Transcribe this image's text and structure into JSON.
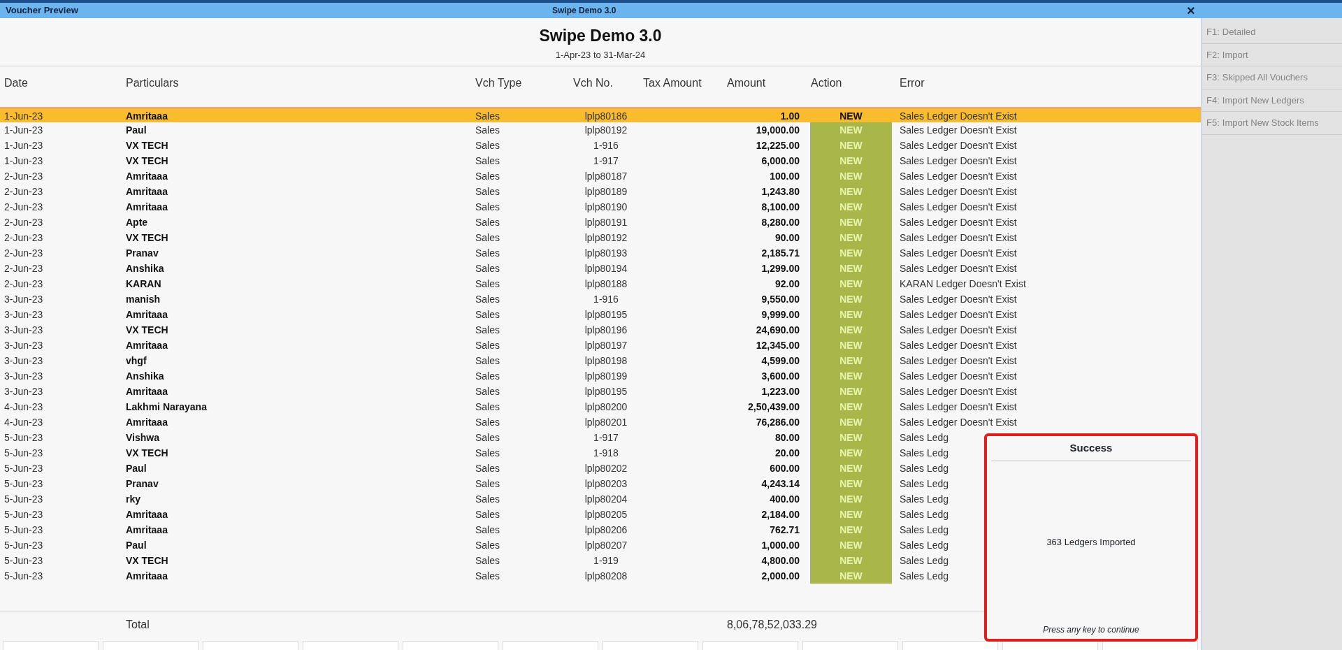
{
  "window": {
    "title": "Voucher Preview",
    "company_tab": "Swipe Demo 3.0",
    "close": "×"
  },
  "report": {
    "company": "Swipe Demo 3.0",
    "period": "1-Apr-23 to 31-Mar-24"
  },
  "table": {
    "columns": [
      "Date",
      "Particulars",
      "Vch Type",
      "Vch No.",
      "Tax Amount",
      "Amount",
      "Action",
      "Error"
    ],
    "rows": [
      {
        "date": "1-Jun-23",
        "particulars": "Amritaaa",
        "vch_type": "Sales",
        "vch_no": "lplp80186",
        "amount": "1.00",
        "action": "NEW",
        "error": "Sales Ledger Doesn't Exist",
        "selected": true
      },
      {
        "date": "1-Jun-23",
        "particulars": "Paul",
        "vch_type": "Sales",
        "vch_no": "lplp80192",
        "amount": "19,000.00",
        "action": "NEW",
        "error": "Sales Ledger Doesn't Exist",
        "selected": false
      },
      {
        "date": "1-Jun-23",
        "particulars": "VX TECH",
        "vch_type": "Sales",
        "vch_no": "1-916",
        "amount": "12,225.00",
        "action": "NEW",
        "error": "Sales Ledger Doesn't Exist",
        "selected": false
      },
      {
        "date": "1-Jun-23",
        "particulars": "VX TECH",
        "vch_type": "Sales",
        "vch_no": "1-917",
        "amount": "6,000.00",
        "action": "NEW",
        "error": "Sales Ledger Doesn't Exist",
        "selected": false
      },
      {
        "date": "2-Jun-23",
        "particulars": "Amritaaa",
        "vch_type": "Sales",
        "vch_no": "lplp80187",
        "amount": "100.00",
        "action": "NEW",
        "error": "Sales Ledger Doesn't Exist",
        "selected": false
      },
      {
        "date": "2-Jun-23",
        "particulars": "Amritaaa",
        "vch_type": "Sales",
        "vch_no": "lplp80189",
        "amount": "1,243.80",
        "action": "NEW",
        "error": "Sales Ledger Doesn't Exist",
        "selected": false
      },
      {
        "date": "2-Jun-23",
        "particulars": "Amritaaa",
        "vch_type": "Sales",
        "vch_no": "lplp80190",
        "amount": "8,100.00",
        "action": "NEW",
        "error": "Sales Ledger Doesn't Exist",
        "selected": false
      },
      {
        "date": "2-Jun-23",
        "particulars": "Apte",
        "vch_type": "Sales",
        "vch_no": "lplp80191",
        "amount": "8,280.00",
        "action": "NEW",
        "error": "Sales Ledger Doesn't Exist",
        "selected": false
      },
      {
        "date": "2-Jun-23",
        "particulars": "VX TECH",
        "vch_type": "Sales",
        "vch_no": "lplp80192",
        "amount": "90.00",
        "action": "NEW",
        "error": "Sales Ledger Doesn't Exist",
        "selected": false
      },
      {
        "date": "2-Jun-23",
        "particulars": "Pranav",
        "vch_type": "Sales",
        "vch_no": "lplp80193",
        "amount": "2,185.71",
        "action": "NEW",
        "error": "Sales Ledger Doesn't Exist",
        "selected": false
      },
      {
        "date": "2-Jun-23",
        "particulars": "Anshika",
        "vch_type": "Sales",
        "vch_no": "lplp80194",
        "amount": "1,299.00",
        "action": "NEW",
        "error": "Sales Ledger Doesn't Exist",
        "selected": false
      },
      {
        "date": "2-Jun-23",
        "particulars": "KARAN",
        "vch_type": "Sales",
        "vch_no": "lplp80188",
        "amount": "92.00",
        "action": "NEW",
        "error": "KARAN Ledger Doesn't Exist",
        "selected": false
      },
      {
        "date": "3-Jun-23",
        "particulars": "manish",
        "vch_type": "Sales",
        "vch_no": "1-916",
        "amount": "9,550.00",
        "action": "NEW",
        "error": "Sales Ledger Doesn't Exist",
        "selected": false
      },
      {
        "date": "3-Jun-23",
        "particulars": "Amritaaa",
        "vch_type": "Sales",
        "vch_no": "lplp80195",
        "amount": "9,999.00",
        "action": "NEW",
        "error": "Sales Ledger Doesn't Exist",
        "selected": false
      },
      {
        "date": "3-Jun-23",
        "particulars": "VX TECH",
        "vch_type": "Sales",
        "vch_no": "lplp80196",
        "amount": "24,690.00",
        "action": "NEW",
        "error": "Sales Ledger Doesn't Exist",
        "selected": false
      },
      {
        "date": "3-Jun-23",
        "particulars": "Amritaaa",
        "vch_type": "Sales",
        "vch_no": "lplp80197",
        "amount": "12,345.00",
        "action": "NEW",
        "error": "Sales Ledger Doesn't Exist",
        "selected": false
      },
      {
        "date": "3-Jun-23",
        "particulars": "vhgf",
        "vch_type": "Sales",
        "vch_no": "lplp80198",
        "amount": "4,599.00",
        "action": "NEW",
        "error": "Sales Ledger Doesn't Exist",
        "selected": false
      },
      {
        "date": "3-Jun-23",
        "particulars": "Anshika",
        "vch_type": "Sales",
        "vch_no": "lplp80199",
        "amount": "3,600.00",
        "action": "NEW",
        "error": "Sales Ledger Doesn't Exist",
        "selected": false
      },
      {
        "date": "3-Jun-23",
        "particulars": "Amritaaa",
        "vch_type": "Sales",
        "vch_no": "lplp80195",
        "amount": "1,223.00",
        "action": "NEW",
        "error": "Sales Ledger Doesn't Exist",
        "selected": false
      },
      {
        "date": "4-Jun-23",
        "particulars": "Lakhmi Narayana",
        "vch_type": "Sales",
        "vch_no": "lplp80200",
        "amount": "2,50,439.00",
        "action": "NEW",
        "error": "Sales Ledger Doesn't Exist",
        "selected": false
      },
      {
        "date": "4-Jun-23",
        "particulars": "Amritaaa",
        "vch_type": "Sales",
        "vch_no": "lplp80201",
        "amount": "76,286.00",
        "action": "NEW",
        "error": "Sales Ledger Doesn't Exist",
        "selected": false
      },
      {
        "date": "5-Jun-23",
        "particulars": "Vishwa",
        "vch_type": "Sales",
        "vch_no": "1-917",
        "amount": "80.00",
        "action": "NEW",
        "error": "Sales Ledg",
        "selected": false
      },
      {
        "date": "5-Jun-23",
        "particulars": "VX TECH",
        "vch_type": "Sales",
        "vch_no": "1-918",
        "amount": "20.00",
        "action": "NEW",
        "error": "Sales Ledg",
        "selected": false
      },
      {
        "date": "5-Jun-23",
        "particulars": "Paul",
        "vch_type": "Sales",
        "vch_no": "lplp80202",
        "amount": "600.00",
        "action": "NEW",
        "error": "Sales Ledg",
        "selected": false
      },
      {
        "date": "5-Jun-23",
        "particulars": "Pranav",
        "vch_type": "Sales",
        "vch_no": "lplp80203",
        "amount": "4,243.14",
        "action": "NEW",
        "error": "Sales Ledg",
        "selected": false
      },
      {
        "date": "5-Jun-23",
        "particulars": "rky",
        "vch_type": "Sales",
        "vch_no": "lplp80204",
        "amount": "400.00",
        "action": "NEW",
        "error": "Sales Ledg",
        "selected": false
      },
      {
        "date": "5-Jun-23",
        "particulars": "Amritaaa",
        "vch_type": "Sales",
        "vch_no": "lplp80205",
        "amount": "2,184.00",
        "action": "NEW",
        "error": "Sales Ledg",
        "selected": false
      },
      {
        "date": "5-Jun-23",
        "particulars": "Amritaaa",
        "vch_type": "Sales",
        "vch_no": "lplp80206",
        "amount": "762.71",
        "action": "NEW",
        "error": "Sales Ledg",
        "selected": false
      },
      {
        "date": "5-Jun-23",
        "particulars": "Paul",
        "vch_type": "Sales",
        "vch_no": "lplp80207",
        "amount": "1,000.00",
        "action": "NEW",
        "error": "Sales Ledg",
        "selected": false
      },
      {
        "date": "5-Jun-23",
        "particulars": "VX TECH",
        "vch_type": "Sales",
        "vch_no": "1-919",
        "amount": "4,800.00",
        "action": "NEW",
        "error": "Sales Ledg",
        "selected": false
      },
      {
        "date": "5-Jun-23",
        "particulars": "Amritaaa",
        "vch_type": "Sales",
        "vch_no": "lplp80208",
        "amount": "2,000.00",
        "action": "NEW",
        "error": "Sales Ledg",
        "selected": false
      }
    ],
    "total": {
      "label": "Total",
      "amount": "8,06,78,52,033.29"
    }
  },
  "side_buttons": [
    {
      "key": "F1:",
      "label": "Detailed",
      "disabled": true
    },
    {
      "key": "F2:",
      "label": "Import",
      "disabled": true
    },
    {
      "key": "F3:",
      "label": "Skipped All Vouchers",
      "disabled": true
    },
    {
      "key": "F4:",
      "label": "Import New Ledgers",
      "disabled": true
    },
    {
      "key": "F5:",
      "label": "Import New Stock Items",
      "disabled": true
    }
  ],
  "dialog": {
    "title": "Success",
    "message": "363 Ledgers Imported",
    "footer": "Press any key to continue"
  }
}
